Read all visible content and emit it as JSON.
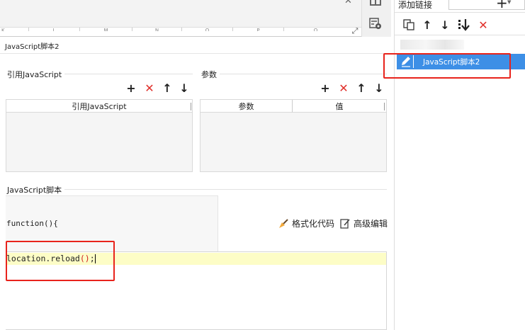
{
  "top_strip": {
    "columns": [
      "K",
      "L",
      "M",
      "N",
      "O",
      "P",
      "Q"
    ]
  },
  "dialog": {
    "title": "JavaScript脚本2",
    "ref_js": {
      "label": "引用JavaScript",
      "column": "引用JavaScript"
    },
    "params": {
      "label": "参数",
      "col_param": "参数",
      "col_value": "值"
    },
    "script": {
      "label": "JavaScript脚本",
      "function_header": "function(){",
      "format_label": "格式化代码",
      "advanced_label": "高级编辑",
      "code_text": "location.reload",
      "code_parens": "()",
      "code_semi": ";"
    }
  },
  "right_panel": {
    "title": "添加链接",
    "add_symbol": "+",
    "selected_item": "JavaScript脚本2"
  },
  "colors": {
    "selected_bg": "#3d8fe6",
    "code_line_bg": "#fdfdc6",
    "highlight_box": "#e8231c"
  }
}
